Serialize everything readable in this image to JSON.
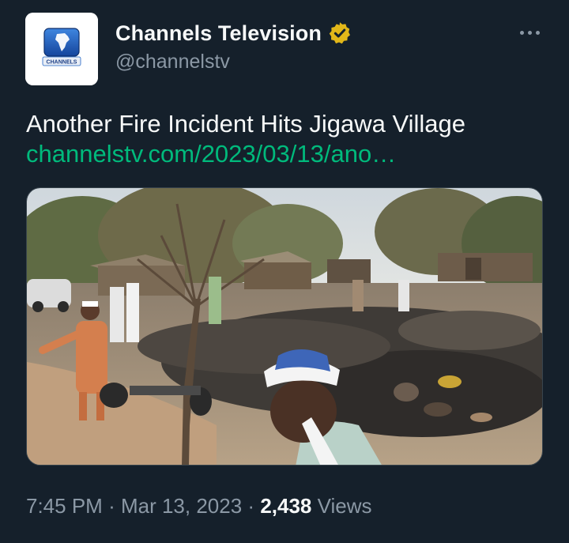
{
  "author": {
    "display_name": "Channels Television",
    "handle": "@channelstv",
    "avatar_text": "CHANNELS",
    "verified_icon": "gold-verified-badge",
    "colors": {
      "verified": "#e2b719",
      "avatar_blue": "#1f63c4"
    }
  },
  "tweet": {
    "text": "Another Fire Incident Hits Jigawa Village",
    "link_text": "channelstv.com/2023/03/13/ano…",
    "link_color": "#00ba7c"
  },
  "media": {
    "icon": "photo-image"
  },
  "meta": {
    "time": "7:45 PM",
    "separator": "·",
    "date": "Mar 13, 2023",
    "views_count": "2,438",
    "views_label": "Views"
  },
  "actions": {
    "more_icon": "more-options-icon"
  },
  "theme": {
    "background": "#15202b",
    "text_primary": "#f7f9f9",
    "text_secondary": "#8b98a5"
  }
}
